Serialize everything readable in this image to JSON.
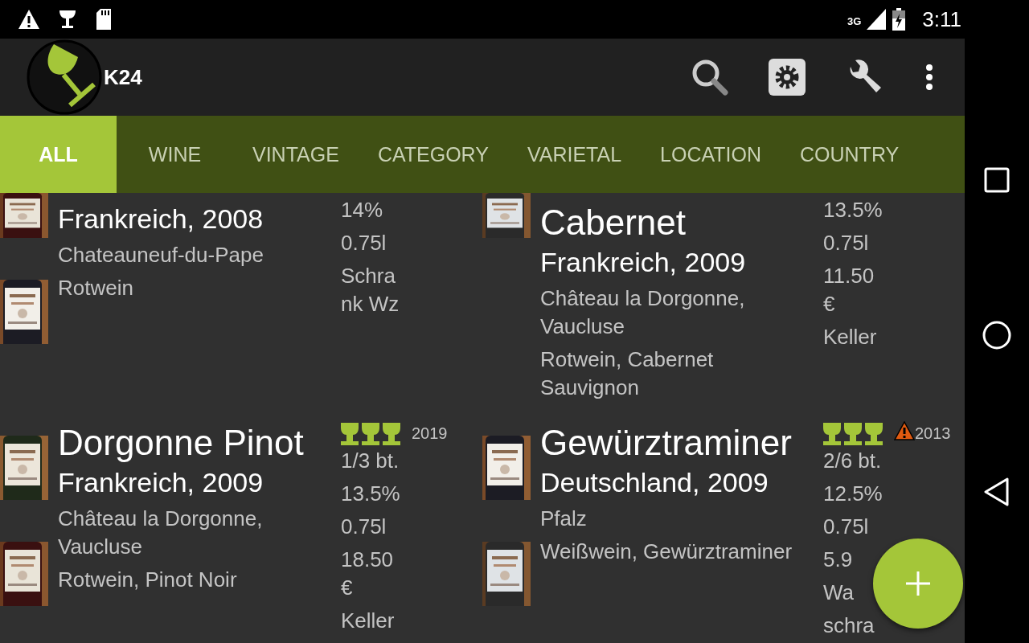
{
  "status_bar": {
    "network": "3G",
    "time": "3:11"
  },
  "toolbar": {
    "title": "K24"
  },
  "tabs": [
    {
      "label": "ALL",
      "selected": true
    },
    {
      "label": "WINE",
      "selected": false
    },
    {
      "label": "VINTAGE",
      "selected": false
    },
    {
      "label": "CATEGORY",
      "selected": false
    },
    {
      "label": "VARIETAL",
      "selected": false
    },
    {
      "label": "LOCATION",
      "selected": false
    },
    {
      "label": "COUNTRY",
      "selected": false
    }
  ],
  "wines": [
    {
      "origin": "Frankreich, 2008",
      "details": [
        "Chateauneuf-du-Pape",
        "Rotwein"
      ],
      "side": [
        "14%",
        "0.75l",
        "Schrank Wz"
      ],
      "photos": [
        {
          "kind": "picture"
        },
        {
          "kind": "picture"
        }
      ]
    },
    {
      "title": "Cabernet",
      "origin": "Frankreich, 2009",
      "details": [
        "Château la Dorgonne, Vaucluse",
        "Rotwein, Cabernet Sauvignon"
      ],
      "side": [
        "13.5%",
        "0.75l",
        "11.50 €",
        "Keller"
      ],
      "photos": [
        {
          "kind": "picture"
        }
      ]
    },
    {
      "title": "Dorgonne Pinot",
      "origin": "Frankreich, 2009",
      "details": [
        "Château la Dorgonne, Vaucluse",
        "Rotwein, Pinot Noir"
      ],
      "stars": 3,
      "warning": false,
      "year": "2019",
      "side": [
        "1/3 bt.",
        "13.5%",
        "0.75l",
        "18.50 €",
        "Keller"
      ],
      "photos": [
        {
          "kind": "picture"
        },
        {
          "kind": "picture"
        }
      ]
    },
    {
      "title": "Gewürztraminer",
      "origin": "Deutschland, 2009",
      "details": [
        "Pfalz",
        "Weißwein, Gewürztraminer"
      ],
      "stars": 3,
      "warning": true,
      "year": "2013",
      "side": [
        "2/6 bt.",
        "12.5%",
        "0.75l",
        "5.9",
        "Wa",
        "schra"
      ],
      "photos": [
        {
          "kind": "picture"
        },
        {
          "kind": "picture"
        }
      ]
    }
  ]
}
